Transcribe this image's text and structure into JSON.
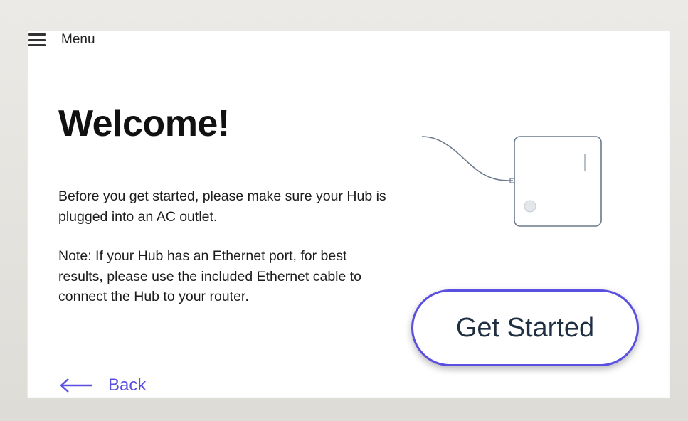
{
  "menu": {
    "label": "Menu",
    "icon": "hamburger-icon"
  },
  "welcome": {
    "title": "Welcome!",
    "paragraph1": "Before you get started, please make sure your Hub is plugged into an AC outlet.",
    "paragraph2": "Note: If your Hub has an Ethernet port, for best results, please use the included Ethernet cable to connect the Hub to your router."
  },
  "actions": {
    "get_started": "Get Started",
    "back": "Back",
    "back_icon": "arrow-left-icon"
  },
  "colors": {
    "accent": "#5a4fe0",
    "button_text": "#1f2f42",
    "text": "#1c1c1c",
    "bezel": "#e6e4df"
  },
  "illustration": {
    "icon": "hub-device-icon"
  }
}
